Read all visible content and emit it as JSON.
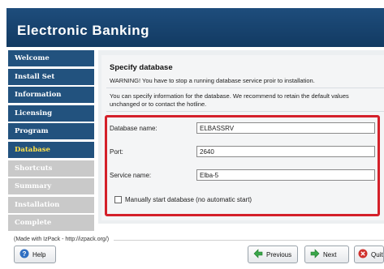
{
  "header": {
    "title": "Electronic Banking"
  },
  "sidebar": {
    "items": [
      {
        "label": "Welcome",
        "state": "done"
      },
      {
        "label": "Install Set",
        "state": "done"
      },
      {
        "label": "Information",
        "state": "done"
      },
      {
        "label": "Licensing",
        "state": "done"
      },
      {
        "label": "Program",
        "state": "done"
      },
      {
        "label": "Database",
        "state": "current"
      },
      {
        "label": "Shortcuts",
        "state": "todo"
      },
      {
        "label": "Summary",
        "state": "todo"
      },
      {
        "label": "Installation",
        "state": "todo"
      },
      {
        "label": "Complete",
        "state": "todo"
      }
    ]
  },
  "main": {
    "section_title": "Specify database",
    "warning": "WARNING! You have to stop a running database service proir to installation.",
    "info": "You can specify information for the database. We recommend to retain the default values unchanged or to contact the hotline.",
    "form": {
      "db_name_label": "Database name:",
      "db_name_value": "ELBASSRV",
      "port_label": "Port:",
      "port_value": "2640",
      "service_label": "Service name:",
      "service_value": "Elba-5",
      "manual_start_label": "Manually start database (no automatic start)",
      "manual_start_checked": false
    }
  },
  "footer": {
    "made_with": "(Made with IzPack - http://izpack.org/)",
    "help_label": "Help",
    "previous_label": "Previous",
    "next_label": "Next",
    "quit_label": "Quit"
  },
  "colors": {
    "header_blue": "#1e4d7c",
    "step_done": "#22527e",
    "step_current_text": "#ffe14a",
    "step_todo": "#c9c9c9",
    "highlight_red": "#d4202a"
  },
  "icons": {
    "help": "help-icon",
    "previous": "arrow-left-icon",
    "next": "arrow-right-icon",
    "quit": "close-icon"
  }
}
